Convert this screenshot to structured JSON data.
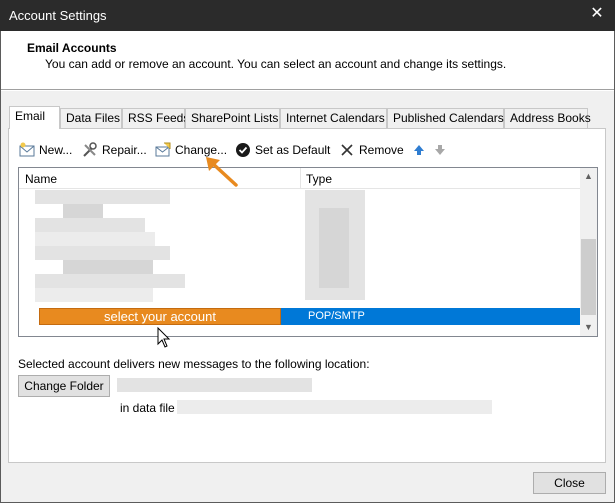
{
  "window": {
    "title": "Account Settings",
    "close_glyph": "✕"
  },
  "header": {
    "title": "Email Accounts",
    "description": "You can add or remove an account. You can select an account and change its settings."
  },
  "tabs": [
    {
      "label": "Email",
      "active": true
    },
    {
      "label": "Data Files",
      "active": false
    },
    {
      "label": "RSS Feeds",
      "active": false
    },
    {
      "label": "SharePoint Lists",
      "active": false
    },
    {
      "label": "Internet Calendars",
      "active": false
    },
    {
      "label": "Published Calendars",
      "active": false
    },
    {
      "label": "Address Books",
      "active": false
    }
  ],
  "toolbar": {
    "new_label": "New...",
    "repair_label": "Repair...",
    "change_label": "Change...",
    "default_label": "Set as Default",
    "remove_label": "Remove",
    "icons": [
      "new-email-icon",
      "repair-tools-icon",
      "change-account-icon",
      "checkmark-circle-icon",
      "remove-x-icon",
      "move-up-arrow-icon",
      "move-down-arrow-icon"
    ]
  },
  "list": {
    "columns": [
      "Name",
      "Type"
    ],
    "selected_row": {
      "name": "select your account",
      "type": "POP/SMTP"
    }
  },
  "delivery": {
    "text": "Selected account delivers new messages to the following location:",
    "change_folder_label": "Change Folder",
    "in_data_file_label": "in data file"
  },
  "footer": {
    "close_label": "Close"
  },
  "colors": {
    "selection": "#0078d7",
    "highlight_annotation": "#e88a1f",
    "title_bar": "#2b2b2b"
  }
}
